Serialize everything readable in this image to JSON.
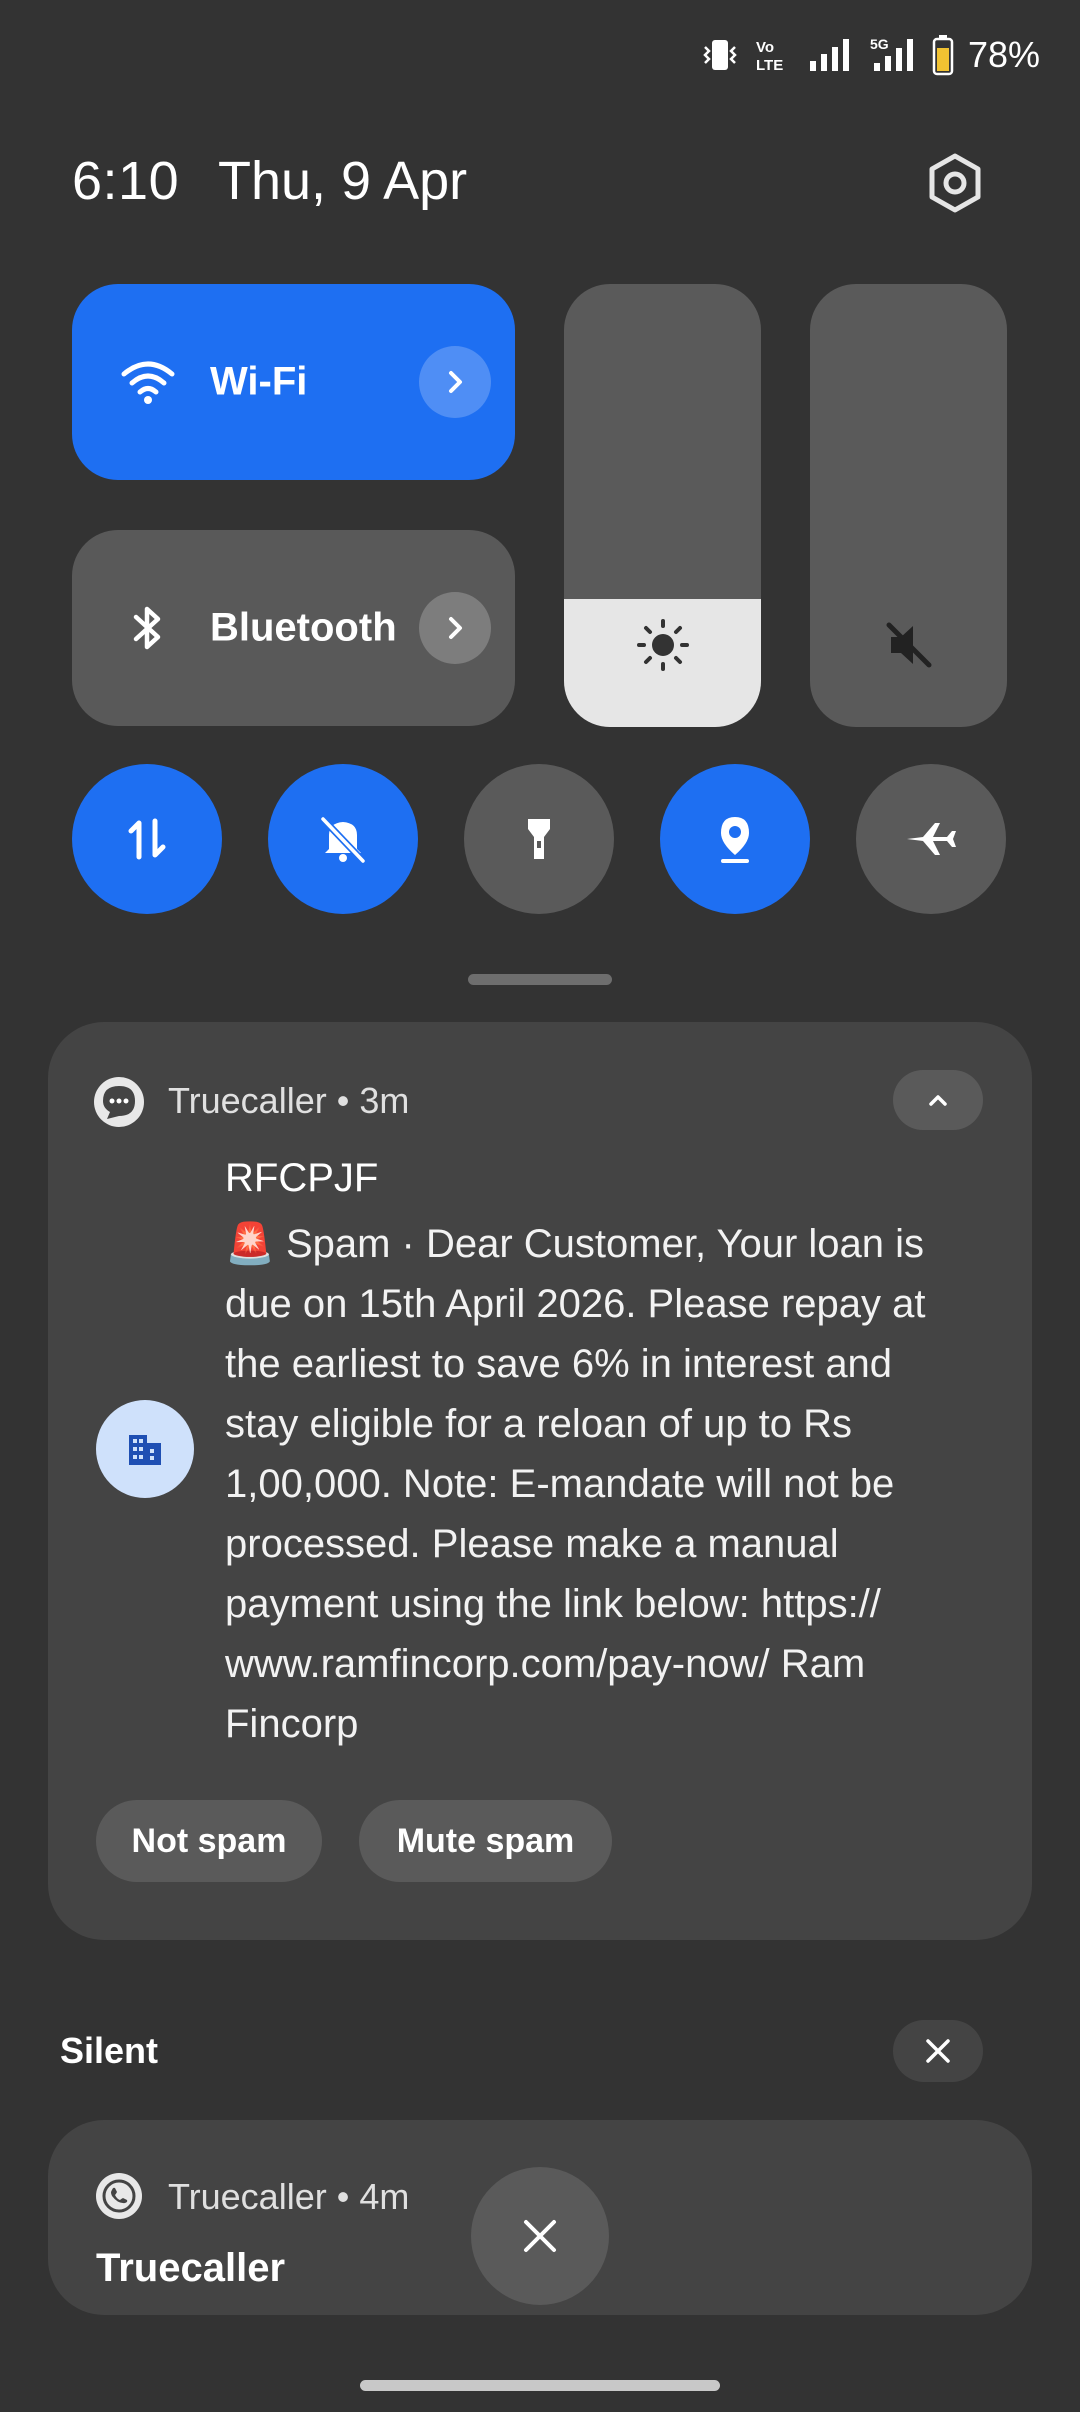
{
  "status_bar": {
    "battery_percent": "78%",
    "icons": [
      "vibrate-icon",
      "volte-icon",
      "signal-icon",
      "5g-signal-icon",
      "battery-icon"
    ],
    "volte_label_top": "Vo",
    "volte_label_bottom": "LTE",
    "network_label": "5G"
  },
  "header": {
    "time": "6:10",
    "date": "Thu, 9 Apr"
  },
  "tiles": {
    "wifi": {
      "label": "Wi-Fi",
      "active": true
    },
    "bluetooth": {
      "label": "Bluetooth",
      "active": false
    }
  },
  "sliders": {
    "brightness_level": 0.29,
    "volume_level": 0.0,
    "volume_muted": true
  },
  "toggles": [
    {
      "name": "mobile-data",
      "icon": "data-transfer-icon",
      "active": true
    },
    {
      "name": "do-not-disturb",
      "icon": "bell-off-icon",
      "active": true
    },
    {
      "name": "flashlight",
      "icon": "flashlight-icon",
      "active": false
    },
    {
      "name": "location",
      "icon": "location-icon",
      "active": true
    },
    {
      "name": "airplane-mode",
      "icon": "airplane-icon",
      "active": false
    }
  ],
  "notification": {
    "app_name": "Truecaller",
    "time_ago": "3m",
    "separator": "•",
    "sender": "RFCPJF",
    "spam_emoji": "🚨",
    "body": "Spam · Dear Customer, Your loan is due on 15th April 2026. Please repay at the earliest to save 6% in interest and stay eligible for a reloan of up to Rs 1,00,000. Note: E-mandate will not be processed. Please make a manual payment using the link below: https:// www.ramfincorp.com/pay-now/ Ram Fincorp",
    "actions": [
      "Not spam",
      "Mute spam"
    ]
  },
  "silent_section": {
    "label": "Silent"
  },
  "silent_notification": {
    "app_name": "Truecaller",
    "time_ago": "4m",
    "separator": "•",
    "title": "Truecaller"
  },
  "colors": {
    "background": "#333333",
    "accent": "#1e6ff2",
    "card": "#444444",
    "tile_off": "#5a5a5a"
  }
}
